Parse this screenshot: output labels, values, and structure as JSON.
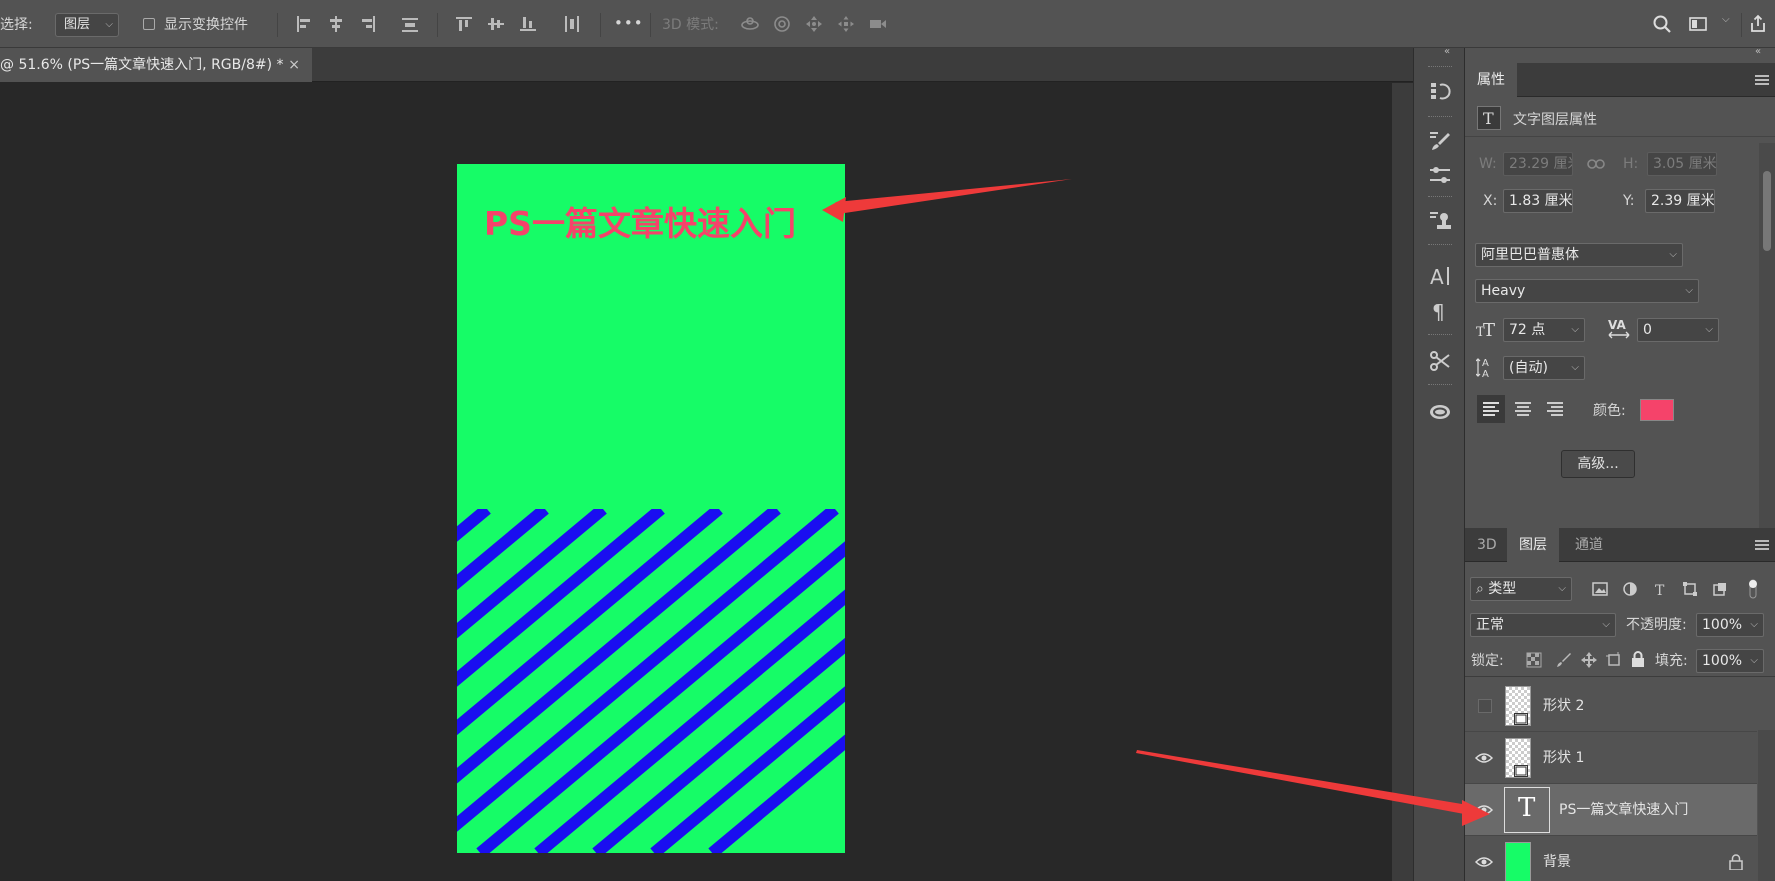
{
  "options_bar": {
    "select_label": "选择:",
    "select_target": "图层",
    "show_transform_label": "显示变换控件",
    "more_label": "•••",
    "mode_3d_label": "3D 模式:"
  },
  "document": {
    "tab_title": "@ 51.6% (PS一篇文章快速入门, RGB/8#) *",
    "close_glyph": "×",
    "artboard_text": "PS一篇文章快速入门",
    "colors": {
      "background": "#16fc67",
      "text": "#f5436a",
      "stripes": "#1a0ef0"
    }
  },
  "properties": {
    "tab_label": "属性",
    "section_title": "文字图层属性",
    "w_label": "W:",
    "w_value": "23.29 厘米",
    "h_label": "H:",
    "h_value": "3.05 厘米",
    "x_label": "X:",
    "x_value": "1.83 厘米",
    "y_label": "Y:",
    "y_value": "2.39 厘米",
    "font_family": "阿里巴巴普惠体",
    "font_style": "Heavy",
    "font_size": "72 点",
    "tracking": "0",
    "leading": "(自动)",
    "color_label": "颜色:",
    "color_swatch": "#f5436a",
    "advanced_button": "高级..."
  },
  "layers_panel": {
    "tabs": [
      "3D",
      "图层",
      "通道"
    ],
    "filter_kind": "类型",
    "blend_mode": "正常",
    "opacity_label": "不透明度:",
    "opacity_value": "100%",
    "lock_label": "锁定:",
    "fill_label": "填充:",
    "fill_value": "100%",
    "layers": [
      {
        "name": "形状 2",
        "visible": false
      },
      {
        "name": "形状 1",
        "visible": true
      },
      {
        "name": "PS一篇文章快速入门",
        "visible": true,
        "selected": true,
        "thumb_glyph": "T"
      },
      {
        "name": "背景",
        "visible": true
      }
    ]
  }
}
